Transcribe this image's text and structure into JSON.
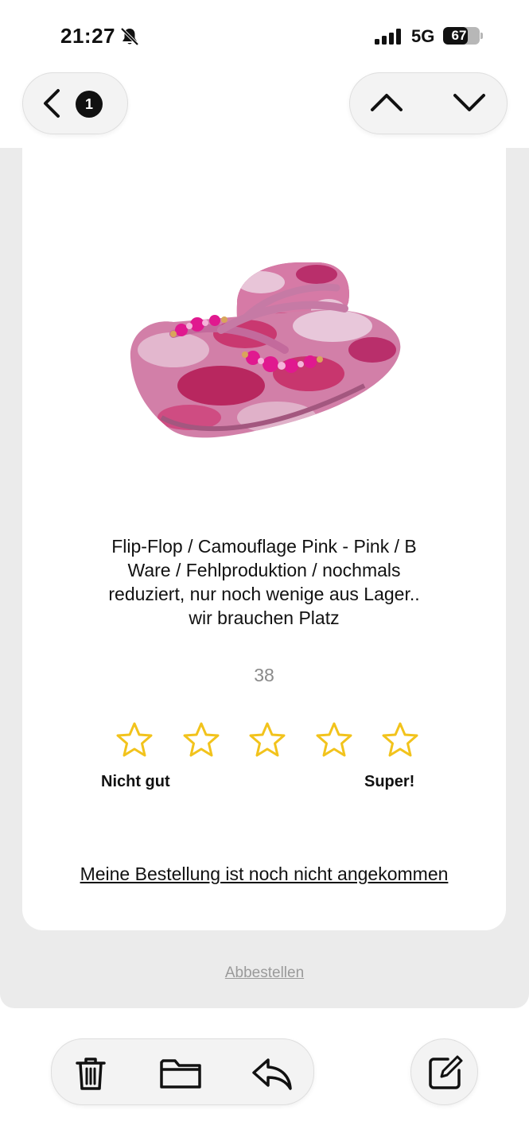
{
  "status_bar": {
    "time": "21:27",
    "network": "5G",
    "battery": "67",
    "battery_level": 0.67
  },
  "nav": {
    "unread_count": "1"
  },
  "product": {
    "title": "Flip-Flop / Camouflage Pink - Pink / B Ware / Fehlproduktion / nochmals reduziert, nur noch wenige aus Lager.. wir brauchen Platz",
    "size": "38"
  },
  "rating": {
    "star_count": 5,
    "star_color": "#f2c31c",
    "low_label": "Nicht gut",
    "high_label": "Super!"
  },
  "links": {
    "not_arrived": "Meine Bestellung ist noch nicht angekommen",
    "unsubscribe": "Abbestellen"
  }
}
